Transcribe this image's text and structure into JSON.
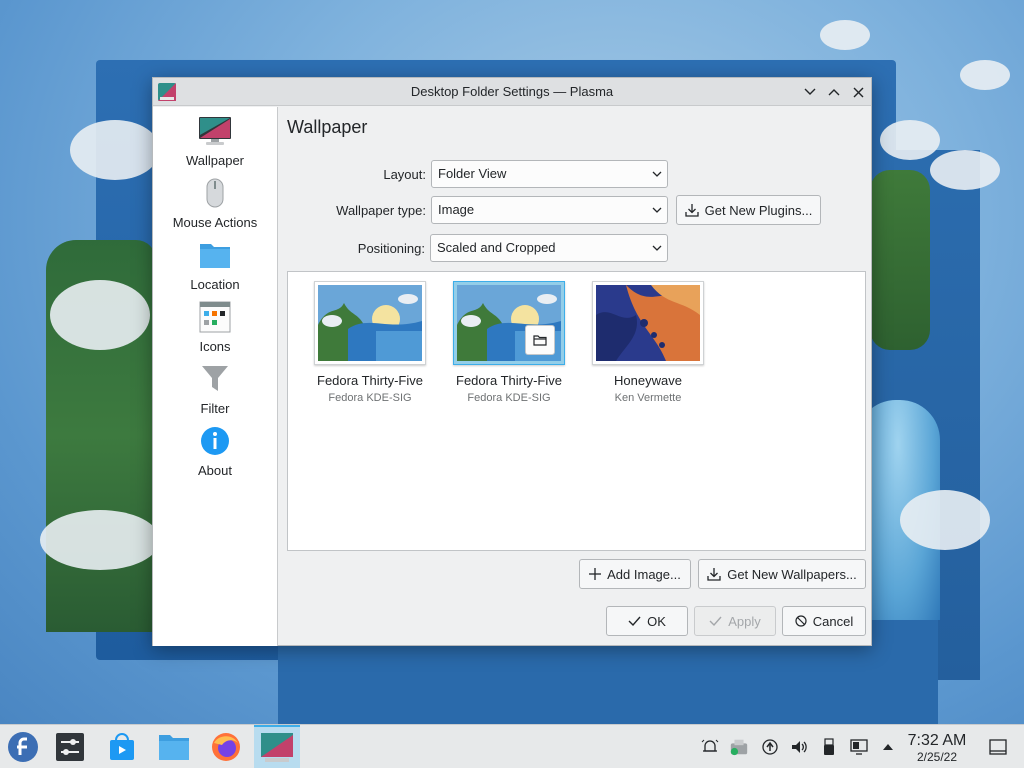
{
  "window": {
    "title": "Desktop Folder Settings — Plasma"
  },
  "sidebar": {
    "items": [
      {
        "label": "Wallpaper",
        "icon": "monitor-icon"
      },
      {
        "label": "Mouse Actions",
        "icon": "mouse-icon"
      },
      {
        "label": "Location",
        "icon": "folder-icon"
      },
      {
        "label": "Icons",
        "icon": "icons-grid-icon"
      },
      {
        "label": "Filter",
        "icon": "filter-icon"
      },
      {
        "label": "About",
        "icon": "info-icon"
      }
    ]
  },
  "content": {
    "page_title": "Wallpaper",
    "layout_label": "Layout:",
    "layout_value": "Folder View",
    "wallpaper_type_label": "Wallpaper type:",
    "wallpaper_type_value": "Image",
    "get_new_plugins": "Get New Plugins...",
    "positioning_label": "Positioning:",
    "positioning_value": "Scaled and Cropped",
    "wallpapers": [
      {
        "name": "Fedora Thirty-Five",
        "author": "Fedora KDE-SIG",
        "selected": false
      },
      {
        "name": "Fedora Thirty-Five",
        "author": "Fedora KDE-SIG",
        "selected": true
      },
      {
        "name": "Honeywave",
        "author": "Ken Vermette",
        "selected": false
      }
    ],
    "add_image": "Add Image...",
    "get_new_wallpapers": "Get New Wallpapers..."
  },
  "footer": {
    "ok": "OK",
    "apply": "Apply",
    "cancel": "Cancel"
  },
  "taskbar": {
    "apps": [
      "fedora-launcher-icon",
      "system-settings-icon",
      "discover-store-icon",
      "file-manager-icon",
      "firefox-icon",
      "desktop-settings-icon"
    ],
    "clock_time": "7:32 AM",
    "clock_date": "2/25/22"
  },
  "colors": {
    "accent": "#3daee9",
    "selection": "#93cee9"
  }
}
